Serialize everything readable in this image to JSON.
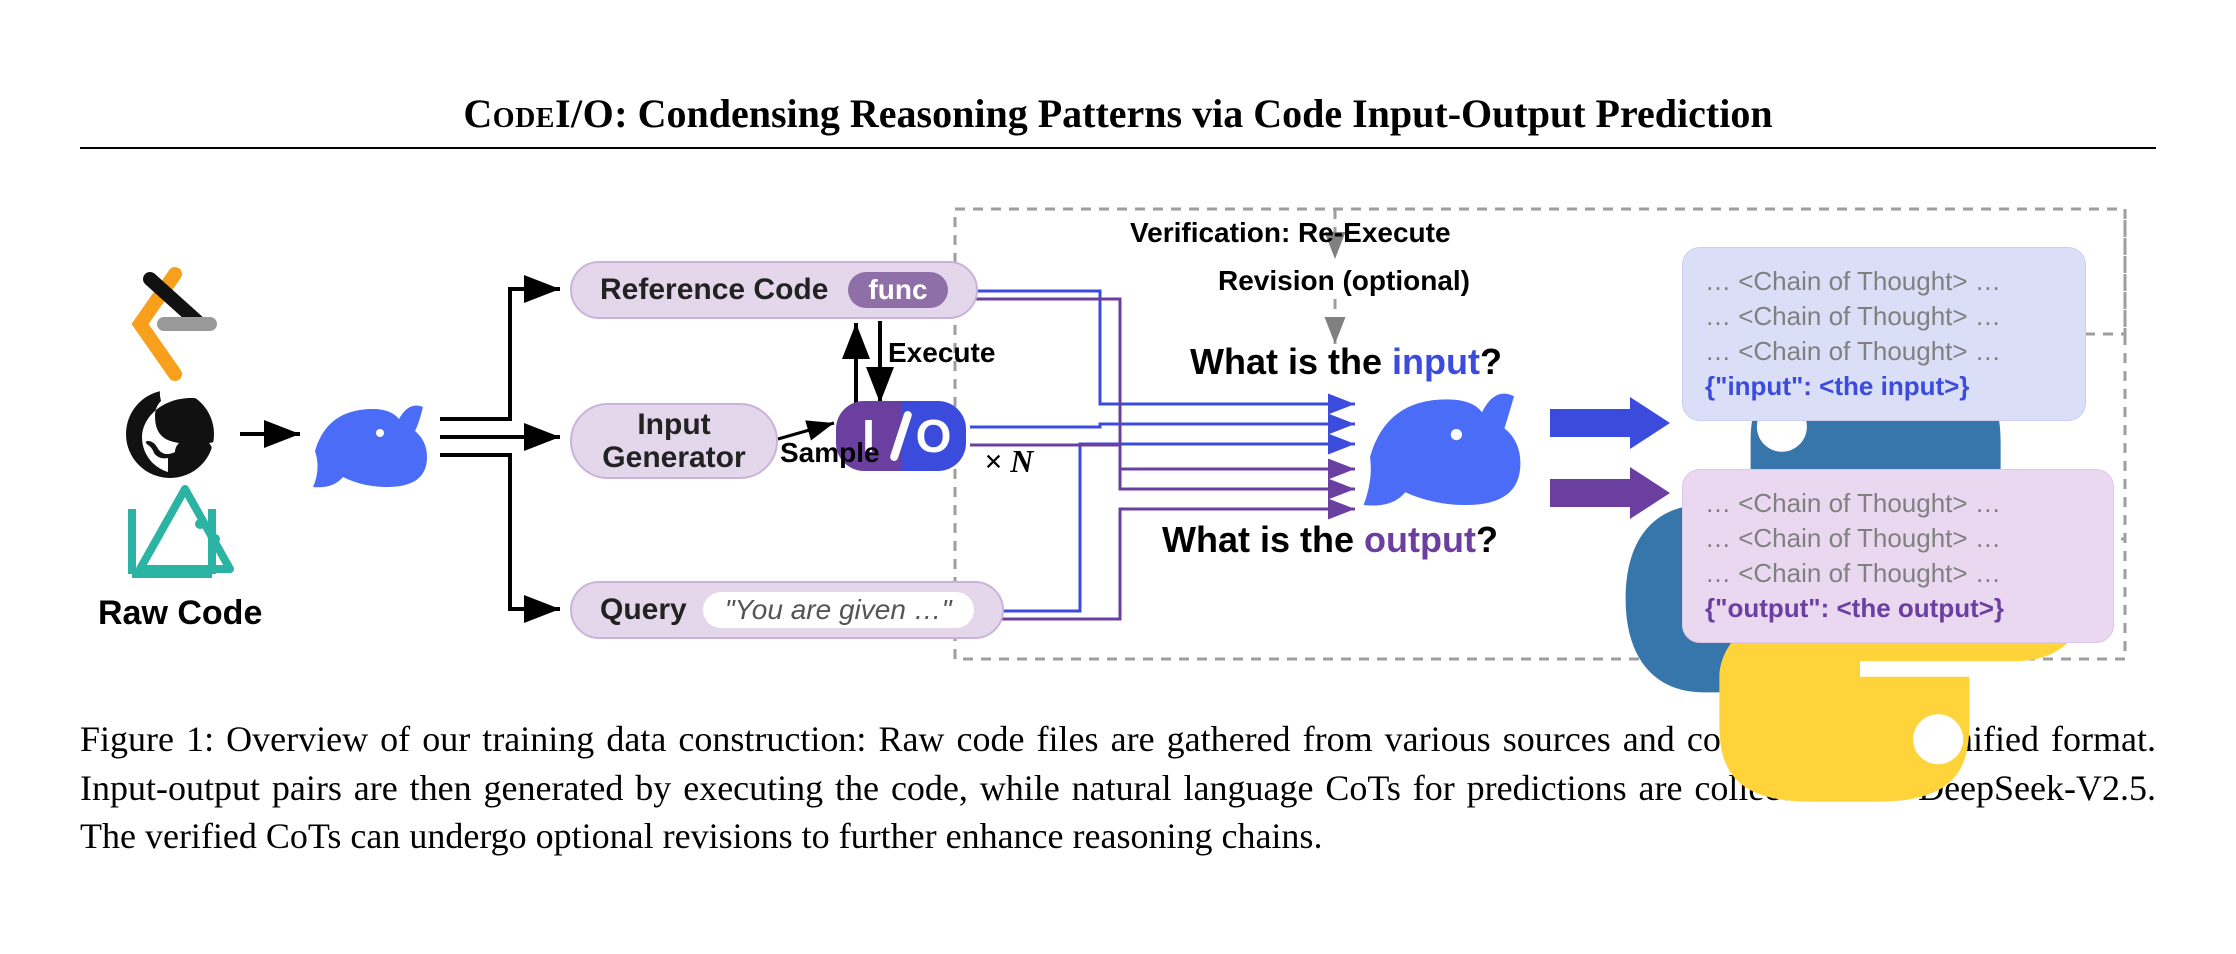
{
  "title": {
    "codeio": "CodeI/O",
    "rest": ": Condensing Reasoning Patterns via Code Input-Output Prediction"
  },
  "figure": {
    "raw_code_label": "Raw Code",
    "reference_code": {
      "label": "Reference Code",
      "badge": "func"
    },
    "input_generator": {
      "line1": "Input",
      "line2": "Generator"
    },
    "query": {
      "label": "Query",
      "quote": "\"You are given …\""
    },
    "execute_label": "Execute",
    "sample_label": "Sample",
    "times_n": "× N",
    "io_i": "I",
    "io_o": "O",
    "verification_label": "Verification: Re-Execute",
    "revision_label_prefix": "Revision",
    "revision_label_optional": "(optional)",
    "question_input_prefix": "What is the ",
    "question_input_kw": "input",
    "question_input_suffix": "?",
    "question_output_prefix": "What is the ",
    "question_output_kw": "output",
    "question_output_suffix": "?",
    "cot_line": "… <Chain of Thought> …",
    "cot_input_json": "{\"input\": <the input>}",
    "cot_output_json": "{\"output\": <the output>}"
  },
  "caption": {
    "prefix": "Figure 1: ",
    "text": "Overview of our training data construction: Raw code files are gathered from various sources and converted into a unified format. Input-output pairs are then generated by executing the code, while natural language CoTs for predictions are collected from DeepSeek-V2.5. The verified CoTs can undergo optional revisions to further enhance reasoning chains."
  }
}
